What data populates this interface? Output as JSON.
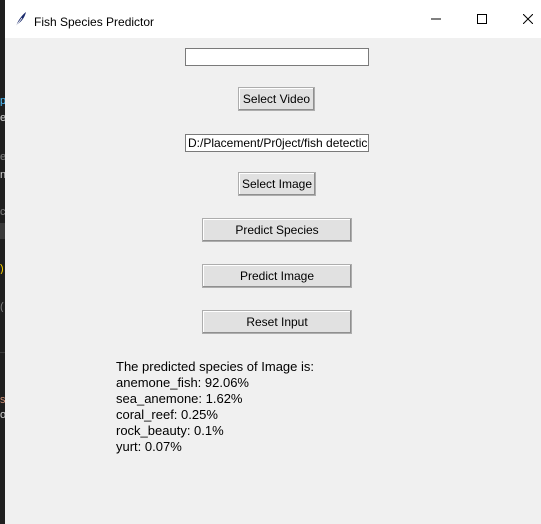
{
  "window": {
    "title": "Fish Species Predictor",
    "icon": "feather-icon"
  },
  "controls": {
    "video_path_value": "",
    "select_video_label": "Select Video",
    "image_path_value": "D:/Placement/Pr0ject/fish detectic",
    "select_image_label": "Select Image",
    "predict_species_label": "Predict Species",
    "predict_image_label": "Predict Image",
    "reset_input_label": "Reset Input"
  },
  "result": {
    "heading": "The predicted species of Image is:",
    "lines": [
      "anemone_fish: 92.06%",
      "sea_anemone: 1.62%",
      "coral_reef: 0.25%",
      "rock_beauty: 0.1%",
      "yurt: 0.07%"
    ]
  },
  "colors": {
    "window_bg": "#f0f0f0",
    "titlebar_bg": "#ffffff",
    "button_bg": "#e1e1e1",
    "editor_bg": "#1f1f1f"
  }
}
